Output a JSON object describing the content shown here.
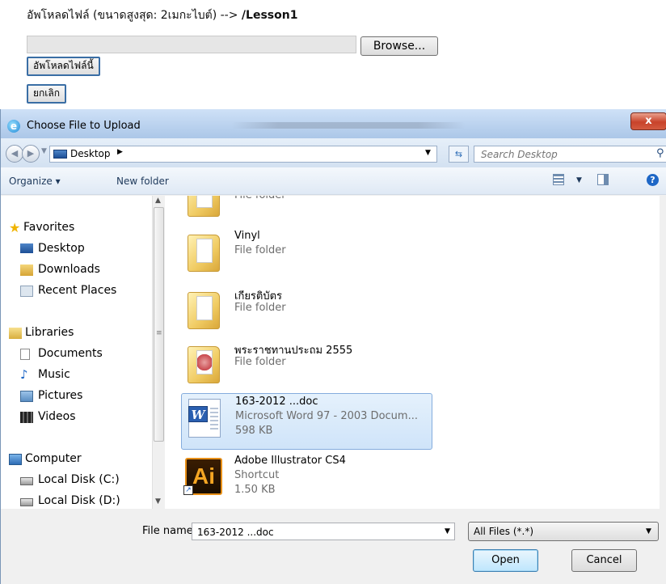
{
  "upload_form": {
    "heading_prefix": "อัพโหลดไฟล์ (ขนาดสูงสุด: 2เมกะไบต์) --> ",
    "heading_folder": "/Lesson1",
    "browse_label": "Browse...",
    "upload_button": "อัพโหลดไฟล์นี้",
    "cancel_button": "ยกเลิก"
  },
  "dialog": {
    "title": "Choose File to Upload",
    "close_label": "x",
    "address": {
      "crumb": "Desktop",
      "arrow": "▶"
    },
    "search_placeholder": "Search Desktop",
    "toolbar": {
      "organize": "Organize ▾",
      "new_folder": "New folder"
    },
    "nav": {
      "favorites": "Favorites",
      "desktop": "Desktop",
      "downloads": "Downloads",
      "recent_places": "Recent Places",
      "libraries": "Libraries",
      "documents": "Documents",
      "music": "Music",
      "pictures": "Pictures",
      "videos": "Videos",
      "computer": "Computer",
      "local_c": "Local Disk (C:)",
      "local_d": "Local Disk (D:)"
    },
    "files": [
      {
        "name": "",
        "type": "File folder",
        "size": ""
      },
      {
        "name": "Vinyl",
        "type": "File folder",
        "size": ""
      },
      {
        "name": "เกียรติบัตร",
        "type": "File folder",
        "size": ""
      },
      {
        "name": "พระราชทานประถม 2555",
        "type": "File folder",
        "size": ""
      },
      {
        "name": "163-2012 ...doc",
        "type": "Microsoft Word 97 - 2003 Docum...",
        "size": "598 KB"
      },
      {
        "name": "Adobe Illustrator CS4",
        "type": "Shortcut",
        "size": "1.50 KB"
      }
    ],
    "file_name_label": "File name:",
    "file_name_value": "163-2012 ...doc",
    "filter": "All Files (*.*)",
    "open_label": "Open",
    "cancel_label": "Cancel",
    "icons": {
      "ai_letters": "Ai",
      "word_letter": "W",
      "help": "?"
    }
  }
}
